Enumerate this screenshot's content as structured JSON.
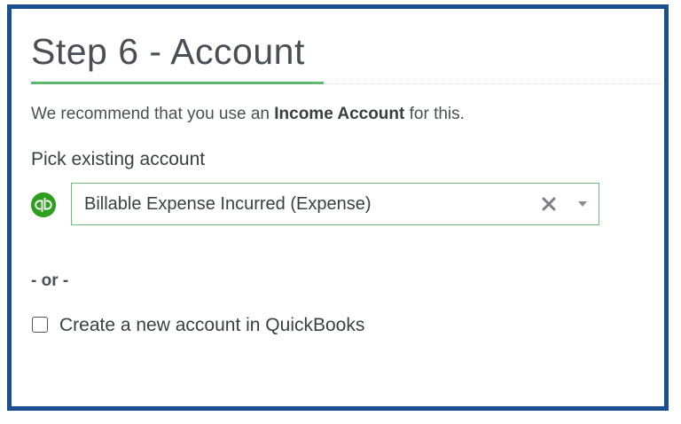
{
  "step": {
    "title": "Step 6 - Account"
  },
  "recommendation": {
    "prefix": "We recommend that you use an ",
    "emphasis": "Income Account",
    "suffix": " for this."
  },
  "pick_existing": {
    "label": "Pick existing account",
    "logo_icon": "quickbooks-logo-icon",
    "selected_value": "Billable Expense Incurred (Expense)",
    "clear_icon": "close-icon",
    "dropdown_icon": "caret-down-icon"
  },
  "separator": {
    "text": "- or -"
  },
  "create_new": {
    "label": "Create a new account in QuickBooks",
    "checked": false
  },
  "colors": {
    "frame_border": "#1b4f8f",
    "accent_green": "#5cb86e",
    "quickbooks_green": "#2ca01c",
    "text": "#3b3f44"
  }
}
